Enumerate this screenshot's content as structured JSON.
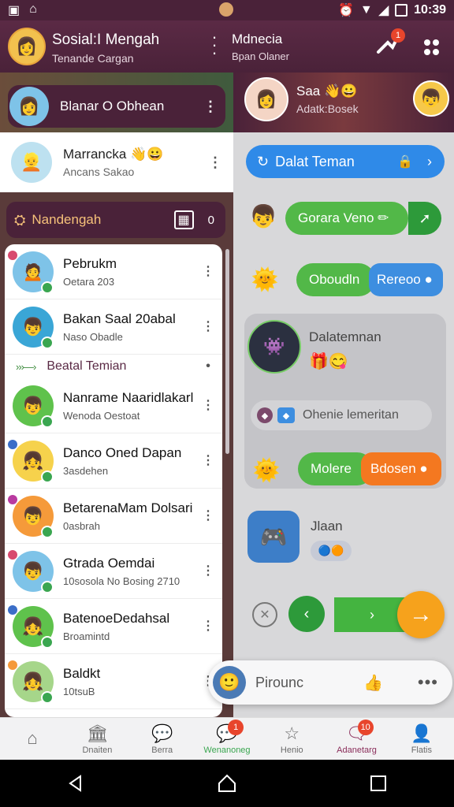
{
  "status_bar": {
    "time": "10:39"
  },
  "header": {
    "title": "Sosial:I Mengah",
    "subtitle": "Tenande Cargan",
    "chat_title": "Mdnecia",
    "chat_subtitle": "Bpan Olaner",
    "share_badge": "1"
  },
  "left": {
    "pinned": {
      "label": "Blanar O Obhean"
    },
    "profile": {
      "name": "Marrancka",
      "status": "Ancans Sakao"
    },
    "section": {
      "label": "Nandengah",
      "count": "0"
    },
    "contacts": [
      {
        "name": "Pebrukm",
        "status": "Oetara 203",
        "bg": "#7ec3e8",
        "dot": "#d84a6e",
        "emoji": "🙍"
      },
      {
        "name": "Bakan Saal 20abal",
        "status": "Naso Obadle",
        "bg": "#3aa6d6",
        "dot": "",
        "emoji": "👦"
      },
      {
        "name": "Nanrame Naaridlakarl",
        "status": "Wenoda Oestoat",
        "bg": "#5fc24c",
        "dot": "",
        "emoji": "👦"
      },
      {
        "name": "Danco Oned Dapan",
        "status": "3asdehen",
        "bg": "#f6d24c",
        "dot": "#3b6ec8",
        "emoji": "👧"
      },
      {
        "name": "BetarenaMam Dolsari",
        "status": "0asbrah",
        "bg": "#f59a3a",
        "dot": "#b93aa0",
        "emoji": "👦"
      },
      {
        "name": "Gtrada Oemdai",
        "status": "10sosola No Bosing 2710",
        "bg": "#7ec3e8",
        "dot": "#d84a6e",
        "emoji": "👦"
      },
      {
        "name": "BatenoeDedahsal",
        "status": "Broamintd",
        "bg": "#5fc24c",
        "dot": "#3b6ec8",
        "emoji": "👧"
      },
      {
        "name": "Baldkt",
        "status": "10tsuB",
        "bg": "#a6d68a",
        "dot": "#f59a3a",
        "emoji": "👧"
      }
    ],
    "divider": {
      "label": "Beatal Temian"
    }
  },
  "right": {
    "user": {
      "name": "Saa",
      "status": "Adatk:Bosek"
    },
    "add_button": "Dalat Teman",
    "bubbles": {
      "b1": "Gorara Veno",
      "b2_green": "Oboudln",
      "b2_blue": "Rereoo",
      "group_title": "Dalatemnan",
      "system_pill": "Ohenie lemeritan",
      "b3_green": "Molere",
      "b3_orange": "Bdosen",
      "game_title": "Jlaan"
    },
    "mini_player": {
      "label": "Pirounc"
    }
  },
  "tabs": [
    {
      "label": "",
      "icon": "home-icon",
      "glyph": "⌂",
      "badge": ""
    },
    {
      "label": "Dnaiten",
      "icon": "building-icon",
      "glyph": "🏛",
      "badge": ""
    },
    {
      "label": "Berra",
      "icon": "chat-bubble-icon",
      "glyph": "💬",
      "badge": ""
    },
    {
      "label": "Wenanoneg",
      "icon": "message-icon",
      "glyph": "💬",
      "badge": "1"
    },
    {
      "label": "Henio",
      "icon": "star-icon",
      "glyph": "☆",
      "badge": ""
    },
    {
      "label": "Adanetarg",
      "icon": "inbox-icon",
      "glyph": "🗨",
      "badge": "10"
    },
    {
      "label": "Flatis",
      "icon": "profile-icon",
      "glyph": "👤",
      "badge": ""
    }
  ]
}
